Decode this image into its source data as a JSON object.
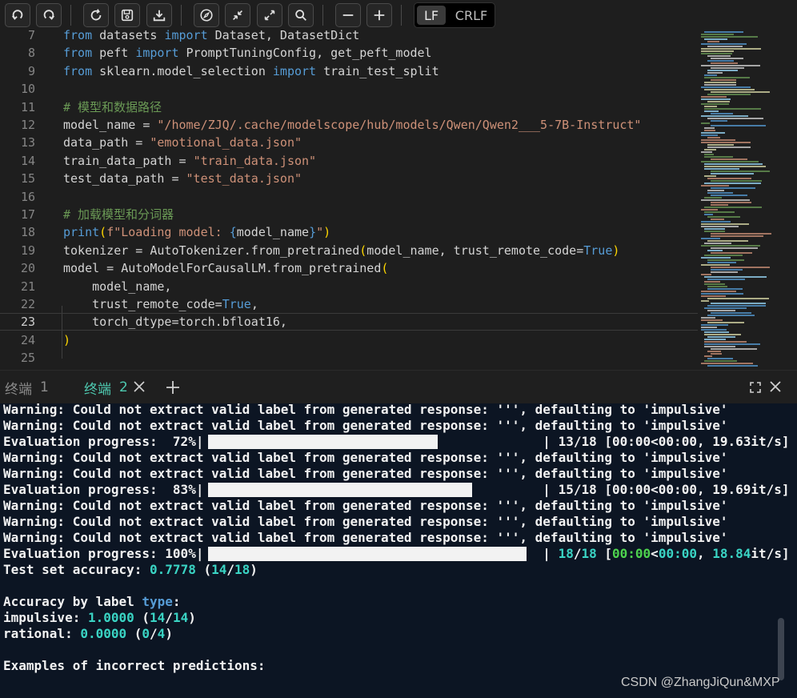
{
  "toolbar": {
    "buttons": [
      "undo-icon",
      "redo-icon",
      "refresh-icon",
      "save-icon",
      "download-icon",
      "compass-icon",
      "collapse-icon",
      "expand-icon",
      "search-icon",
      "zoom-out-icon",
      "zoom-in-icon"
    ],
    "eol_lf": "LF",
    "eol_crlf": "CRLF",
    "eol_selected": "LF"
  },
  "editor": {
    "lines": [
      {
        "n": "7",
        "html": "<span class=\"kw\">from</span> datasets <span class=\"kw\">import</span> Dataset, DatasetDict"
      },
      {
        "n": "8",
        "html": "<span class=\"kw\">from</span> peft <span class=\"kw\">import</span> PromptTuningConfig, get_peft_model"
      },
      {
        "n": "9",
        "html": "<span class=\"kw\">from</span> sklearn.model_selection <span class=\"kw\">import</span> train_test_split"
      },
      {
        "n": "10",
        "html": ""
      },
      {
        "n": "11",
        "html": "<span class=\"cm\"># 模型和数据路径</span>"
      },
      {
        "n": "12",
        "html": "model_name = <span class=\"str\">\"/home/ZJQ/.cache/modelscope/hub/models/Qwen/Qwen2___5-7B-Instruct\"</span>"
      },
      {
        "n": "13",
        "html": "data_path = <span class=\"str\">\"emotional_data.json\"</span>"
      },
      {
        "n": "14",
        "html": "train_data_path = <span class=\"str\">\"train_data.json\"</span>"
      },
      {
        "n": "15",
        "html": "test_data_path = <span class=\"str\">\"test_data.json\"</span>"
      },
      {
        "n": "16",
        "html": ""
      },
      {
        "n": "17",
        "html": "<span class=\"cm\"># 加载模型和分词器</span>"
      },
      {
        "n": "18",
        "html": "<span class=\"kw\">print</span><span class=\"br\">(</span><span class=\"str\">f\"Loading model: </span><span class=\"kw\">{</span>model_name<span class=\"kw\">}</span><span class=\"str\">\"</span><span class=\"br\">)</span>"
      },
      {
        "n": "19",
        "html": "tokenizer = AutoTokenizer.from_pretrained<span class=\"br\">(</span>model_name, trust_remote_code=<span class=\"const\">True</span><span class=\"br\">)</span>"
      },
      {
        "n": "20",
        "html": "model = AutoModelForCausalLM.from_pretrained<span class=\"br\">(</span>"
      },
      {
        "n": "21",
        "html": "    model_name,"
      },
      {
        "n": "22",
        "html": "    trust_remote_code=<span class=\"const\">True</span>,"
      },
      {
        "n": "23",
        "html": "    torch_dtype=torch.bfloat16,"
      },
      {
        "n": "24",
        "html": "<span class=\"br\">)</span>"
      },
      {
        "n": "25",
        "html": ""
      }
    ],
    "current_line": "23"
  },
  "panel": {
    "tab1_label": "终端",
    "tab1_num": "1",
    "tab2_label": "终端",
    "tab2_num": "2"
  },
  "terminal": {
    "lines": [
      {
        "html": "Warning: Could not extract valid label from generated response: ''', defaulting to 'impulsive'"
      },
      {
        "html": "Warning: Could not extract valid label from generated response: ''', defaulting to 'impulsive'"
      },
      {
        "html": "Evaluation progress:  72%|                                            | 13/18 [00:00&lt;00:00, 19.63it/s]",
        "progress": 0.72
      },
      {
        "html": "Warning: Could not extract valid label from generated response: ''', defaulting to 'impulsive'"
      },
      {
        "html": "Warning: Could not extract valid label from generated response: ''', defaulting to 'impulsive'"
      },
      {
        "html": "Evaluation progress:  83%|                                            | 15/18 [00:00&lt;00:00, 19.69it/s]",
        "progress": 0.83
      },
      {
        "html": "Warning: Could not extract valid label from generated response: ''', defaulting to 'impulsive'"
      },
      {
        "html": "Warning: Could not extract valid label from generated response: ''', defaulting to 'impulsive'"
      },
      {
        "html": "Warning: Could not extract valid label from generated response: ''', defaulting to 'impulsive'"
      },
      {
        "html": "Evaluation progress: 100%|                                            | <span class=\"cy\">18</span>/<span class=\"cy\">18</span> [<span class=\"gr\">00:00</span>&lt;<span class=\"cy\">00:00</span>, <span class=\"cy\">18.84</span>it/s]",
        "progress": 1.0
      },
      {
        "html": "Test set accuracy: <span class=\"cy\">0.7778</span> (<span class=\"cy\">14</span>/<span class=\"cy\">18</span>)"
      },
      {
        "html": ""
      },
      {
        "html": "Accuracy by label <span class=\"tb\">type</span>:"
      },
      {
        "html": "impulsive: <span class=\"cy\">1.0000</span> (<span class=\"cy\">14</span>/<span class=\"cy\">14</span>)"
      },
      {
        "html": "rational: <span class=\"cy\">0.0000</span> (<span class=\"cy\">0</span>/<span class=\"cy\">4</span>)"
      },
      {
        "html": ""
      },
      {
        "html": "Examples of incorrect predictions:"
      }
    ]
  },
  "watermark": "CSDN @ZhangJiQun&MXP"
}
